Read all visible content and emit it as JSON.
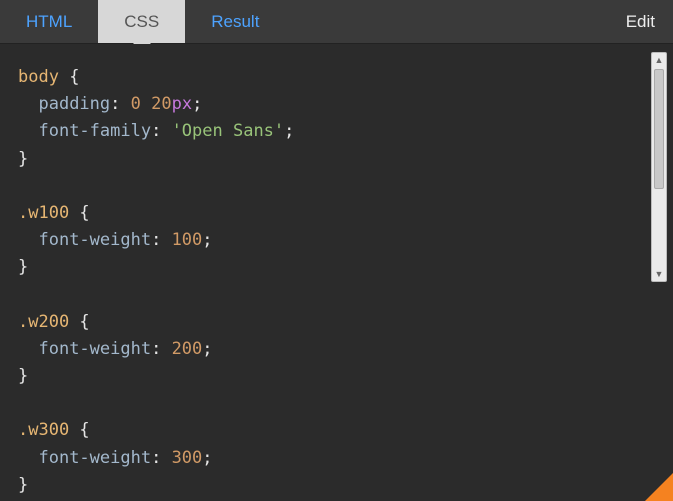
{
  "toolbar": {
    "tabs": [
      {
        "label": "HTML",
        "active": false
      },
      {
        "label": "CSS",
        "active": true
      },
      {
        "label": "Result",
        "active": false
      }
    ],
    "edit_label": "Edit"
  },
  "code": {
    "rules": [
      {
        "selector": "body",
        "declarations": [
          {
            "property": "padding",
            "value": [
              {
                "t": "num",
                "v": "0"
              },
              {
                "t": "txt",
                "v": " "
              },
              {
                "t": "num",
                "v": "20"
              },
              {
                "t": "unit",
                "v": "px"
              }
            ]
          },
          {
            "property": "font-family",
            "value": [
              {
                "t": "str",
                "v": "'Open Sans'"
              }
            ]
          }
        ]
      },
      {
        "selector": ".w100",
        "declarations": [
          {
            "property": "font-weight",
            "value": [
              {
                "t": "num",
                "v": "100"
              }
            ]
          }
        ]
      },
      {
        "selector": ".w200",
        "declarations": [
          {
            "property": "font-weight",
            "value": [
              {
                "t": "num",
                "v": "200"
              }
            ]
          }
        ]
      },
      {
        "selector": ".w300",
        "declarations": [
          {
            "property": "font-weight",
            "value": [
              {
                "t": "num",
                "v": "300"
              }
            ]
          }
        ]
      }
    ]
  }
}
